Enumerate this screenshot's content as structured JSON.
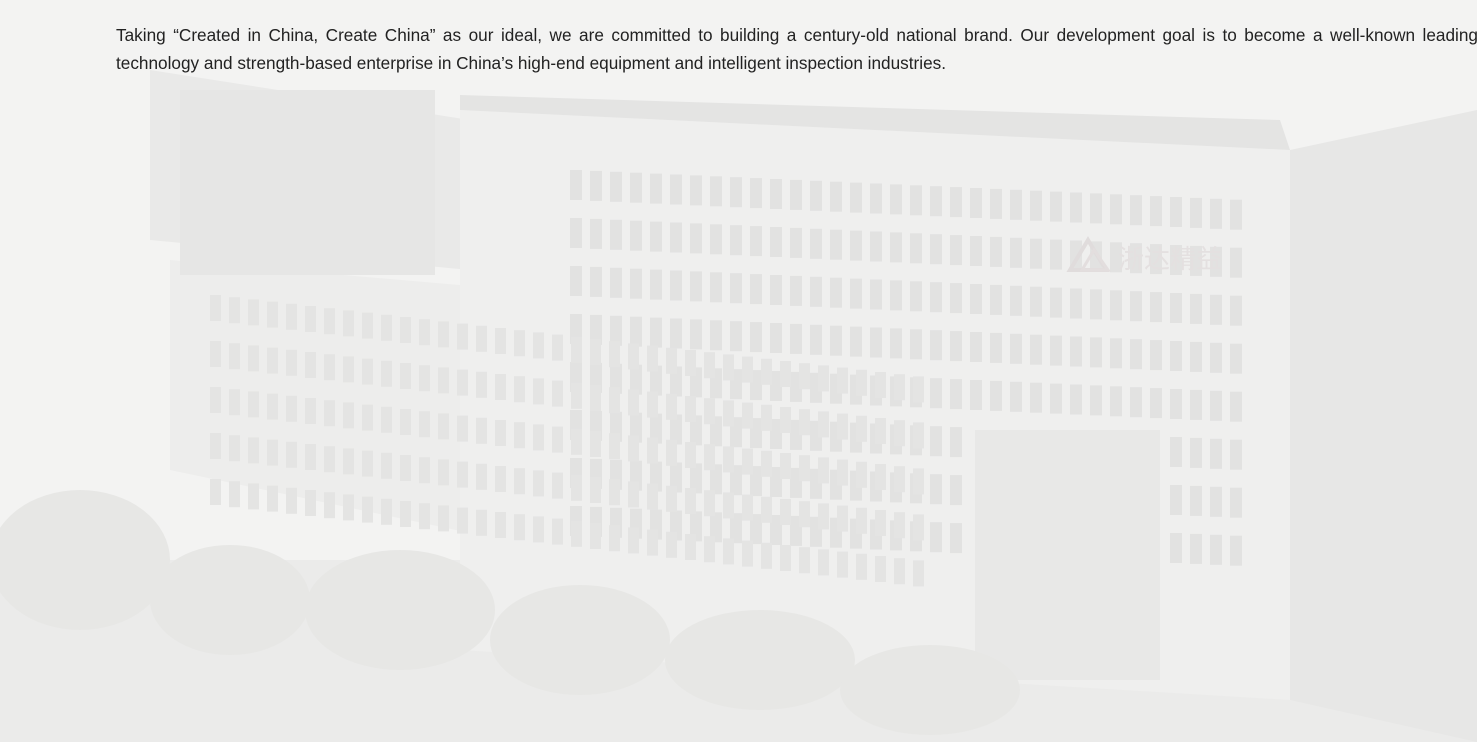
{
  "intro": {
    "text": "Taking “Created in China, Create China” as our ideal, we are committed to building a century-old national brand. Our development goal is to become a well-known leading technology and strength-based enterprise in China’s high-end equipment and intelligent inspection industries."
  },
  "background": {
    "watermark_logo_text": "浙达精益"
  },
  "colors": {
    "text": "#222222",
    "background": "#f1f1f0"
  }
}
